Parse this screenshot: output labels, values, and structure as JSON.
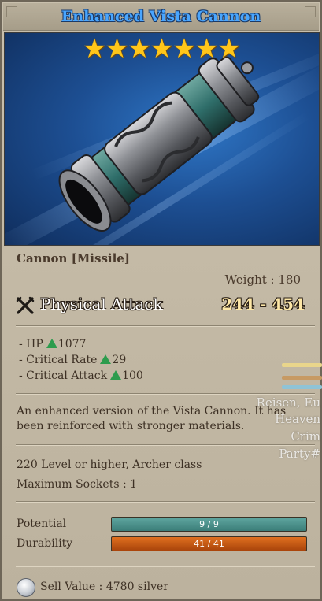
{
  "item": {
    "name": "Enhanced Vista Cannon",
    "stars": [
      "★",
      "★",
      "★",
      "★",
      "★",
      "★",
      "★"
    ],
    "type": "Cannon [Missile]",
    "weight": "Weight : 180",
    "attack_label": "Physical Attack",
    "attack_value": "244 - 454",
    "bonuses": [
      {
        "label": "- HP",
        "value": "1077"
      },
      {
        "label": "- Critical Rate",
        "value": "29"
      },
      {
        "label": "- Critical Attack",
        "value": "100"
      }
    ],
    "description": "An enhanced version of the Vista Cannon. It has been reinforced with stronger materials.",
    "requirement": "220 Level or higher, Archer class",
    "sockets": "Maximum Sockets : 1",
    "potential_label": "Potential",
    "potential_value": "9 / 9",
    "potential_fraction": 1.0,
    "durability_label": "Durability",
    "durability_value": "41 / 41",
    "durability_fraction": 1.0,
    "sell_value": "Sell Value : 4780 silver"
  },
  "background_text": [
    "Reisen, Eu",
    "Heaven",
    "Crim",
    "Party#"
  ],
  "colors": {
    "title": "#49a6ff",
    "stars": "#ffc61a",
    "attack_value": "#fde7a6",
    "bonus_arrow": "#2c9c4d",
    "potential_bar": "#4a908a",
    "durability_bar": "#c25512"
  },
  "icons": {
    "attack": "crossed-swords-icon",
    "bonus": "green-up-triangle-icon",
    "currency": "silver-coin-icon"
  }
}
